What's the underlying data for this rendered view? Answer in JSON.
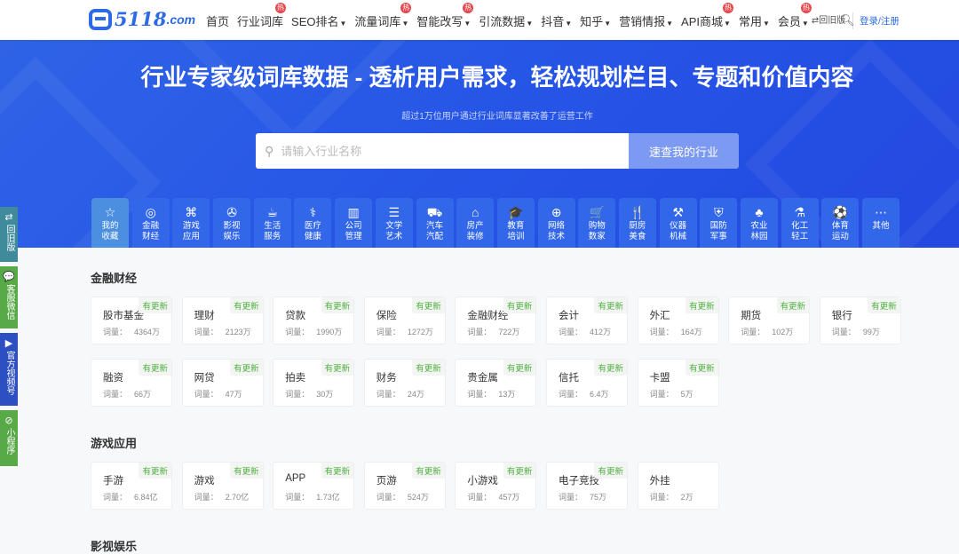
{
  "nav": {
    "logo": "5118",
    "logo_suffix": ".com",
    "items": [
      {
        "label": "首页",
        "dd": false,
        "hot": false
      },
      {
        "label": "行业词库",
        "dd": false,
        "hot": true
      },
      {
        "label": "SEO排名",
        "dd": true,
        "hot": false
      },
      {
        "label": "流量词库",
        "dd": true,
        "hot": true
      },
      {
        "label": "智能改写",
        "dd": true,
        "hot": true
      },
      {
        "label": "引流数据",
        "dd": true,
        "hot": false
      },
      {
        "label": "抖音",
        "dd": true,
        "hot": false
      },
      {
        "label": "知乎",
        "dd": true,
        "hot": false
      },
      {
        "label": "营销情报",
        "dd": true,
        "hot": false
      },
      {
        "label": "API商城",
        "dd": true,
        "hot": true
      },
      {
        "label": "常用",
        "dd": true,
        "hot": false
      },
      {
        "label": "会员",
        "dd": true,
        "hot": true
      }
    ],
    "hot_label": "热",
    "old_version": "⇄回旧版",
    "login": "登录/注册"
  },
  "hero": {
    "title": "行业专家级词库数据 - 透析用户需求，轻松规划栏目、专题和价值内容",
    "subtitle": "超过1万位用户通过行业词库显著改善了运营工作",
    "placeholder": "请输入行业名称",
    "button": "速查我的行业"
  },
  "categories": [
    {
      "l1": "我的",
      "l2": "收藏",
      "icon": "☆"
    },
    {
      "l1": "金融",
      "l2": "财经",
      "icon": "◎"
    },
    {
      "l1": "游戏",
      "l2": "应用",
      "icon": "⌘"
    },
    {
      "l1": "影视",
      "l2": "娱乐",
      "icon": "✇"
    },
    {
      "l1": "生活",
      "l2": "服务",
      "icon": "☕"
    },
    {
      "l1": "医疗",
      "l2": "健康",
      "icon": "⚕"
    },
    {
      "l1": "公司",
      "l2": "管理",
      "icon": "▥"
    },
    {
      "l1": "文学",
      "l2": "艺术",
      "icon": "☰"
    },
    {
      "l1": "汽车",
      "l2": "汽配",
      "icon": "⛟"
    },
    {
      "l1": "房产",
      "l2": "装修",
      "icon": "⌂"
    },
    {
      "l1": "教育",
      "l2": "培训",
      "icon": "🎓"
    },
    {
      "l1": "网络",
      "l2": "技术",
      "icon": "⊕"
    },
    {
      "l1": "购物",
      "l2": "数家",
      "icon": "🛒"
    },
    {
      "l1": "厨房",
      "l2": "美食",
      "icon": "🍴"
    },
    {
      "l1": "仪器",
      "l2": "机械",
      "icon": "⚒"
    },
    {
      "l1": "国防",
      "l2": "军事",
      "icon": "⛨"
    },
    {
      "l1": "农业",
      "l2": "林园",
      "icon": "♣"
    },
    {
      "l1": "化工",
      "l2": "轻工",
      "icon": "⚗"
    },
    {
      "l1": "体育",
      "l2": "运动",
      "icon": "⚽"
    },
    {
      "l1": "其他",
      "l2": "",
      "icon": "⋯"
    }
  ],
  "side": [
    {
      "label": "回旧版",
      "icon": "⇄",
      "color": "#3f8b9c"
    },
    {
      "label": "客服微信",
      "icon": "💬",
      "color": "#58a947"
    },
    {
      "label": "官方视频号",
      "icon": "▶",
      "color": "#2c50c2"
    },
    {
      "label": "小程序",
      "icon": "⊘",
      "color": "#58a947"
    }
  ],
  "badge": "有更新",
  "vol_label": "词量：",
  "sections": [
    {
      "title": "金融财经",
      "cards": [
        {
          "n": "股市基金",
          "v": "4364万"
        },
        {
          "n": "理财",
          "v": "2123万"
        },
        {
          "n": "贷款",
          "v": "1990万"
        },
        {
          "n": "保险",
          "v": "1272万"
        },
        {
          "n": "金融财经",
          "v": "722万"
        },
        {
          "n": "会计",
          "v": "412万"
        },
        {
          "n": "外汇",
          "v": "164万"
        },
        {
          "n": "期货",
          "v": "102万"
        },
        {
          "n": "银行",
          "v": "99万"
        },
        {
          "n": "融资",
          "v": "66万"
        },
        {
          "n": "网贷",
          "v": "47万"
        },
        {
          "n": "拍卖",
          "v": "30万"
        },
        {
          "n": "财务",
          "v": "24万"
        },
        {
          "n": "贵金属",
          "v": "13万"
        },
        {
          "n": "信托",
          "v": "6.4万"
        },
        {
          "n": "卡盟",
          "v": "5万"
        }
      ]
    },
    {
      "title": "游戏应用",
      "cards": [
        {
          "n": "手游",
          "v": "6.84亿"
        },
        {
          "n": "游戏",
          "v": "2.70亿"
        },
        {
          "n": "APP",
          "v": "1.73亿"
        },
        {
          "n": "页游",
          "v": "524万"
        },
        {
          "n": "小游戏",
          "v": "457万"
        },
        {
          "n": "电子竞技",
          "v": "75万"
        },
        {
          "n": "外挂",
          "v": "2万",
          "nobadge": true
        }
      ]
    },
    {
      "title": "影视娱乐",
      "cards": []
    }
  ]
}
